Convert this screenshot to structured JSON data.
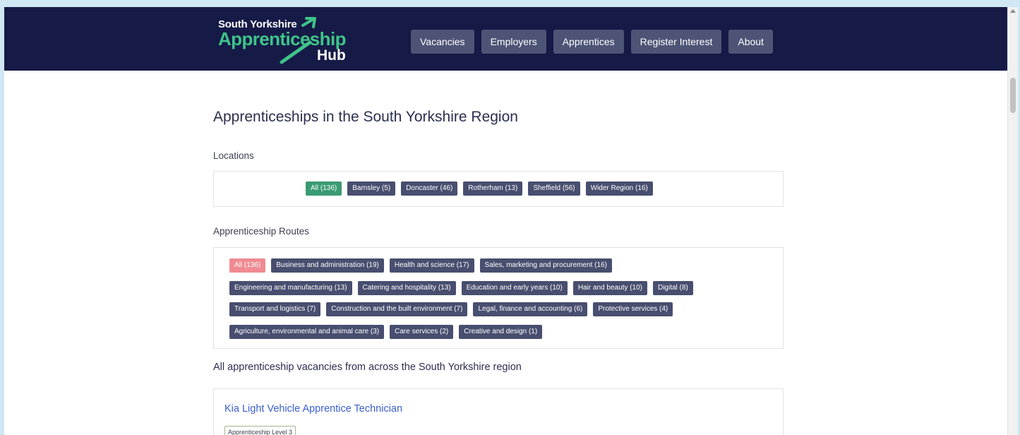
{
  "header": {
    "logo": {
      "line1": "South Yorkshire",
      "line2": "Apprenticeship",
      "line3": "Hub"
    },
    "nav": [
      {
        "label": "Vacancies"
      },
      {
        "label": "Employers"
      },
      {
        "label": "Apprentices"
      },
      {
        "label": "Register Interest"
      },
      {
        "label": "About"
      }
    ]
  },
  "main": {
    "title": "Apprenticeships in the South Yorkshire Region",
    "locations": {
      "label": "Locations",
      "tags": [
        {
          "label": "All (136)",
          "active": true
        },
        {
          "label": "Barnsley (5)"
        },
        {
          "label": "Doncaster (46)"
        },
        {
          "label": "Rotherham (13)"
        },
        {
          "label": "Sheffield (56)"
        },
        {
          "label": "Wider Region (16)"
        }
      ]
    },
    "routes": {
      "label": "Apprenticeship Routes",
      "rows": [
        [
          "All (136)",
          "Business and administration (19)",
          "Health and science (17)",
          "Sales, marketing and procurement (16)"
        ],
        [
          "Engineering and manufacturing (13)",
          "Catering and hospitality (13)",
          "Education and early years (10)",
          "Hair and beauty (10)",
          "Digital (8)"
        ],
        [
          "Transport and logistics (7)",
          "Construction and the built environment (7)",
          "Legal, finance and accounting (6)",
          "Protective services (4)"
        ],
        [
          "Agriculture, environmental and animal care (3)",
          "Care services (2)",
          "Creative and design (1)"
        ]
      ]
    },
    "vacancies_heading": "All apprenticeship vacancies from across the South Yorkshire region",
    "vacancy": {
      "title": "Kia Light Vehicle Apprentice Technician",
      "level": "Apprenticeship Level 3"
    }
  },
  "colors": {
    "navbar": "#161a47",
    "nav_button": "#4d5475",
    "tag": "#484e6f",
    "tag_active_location": "#3a9b73",
    "tag_active_route": "#f08a92",
    "brand_green": "#3fc489",
    "link": "#3a5fd0"
  },
  "icons": {
    "logo_arrow": "arrow-up-right-icon"
  }
}
